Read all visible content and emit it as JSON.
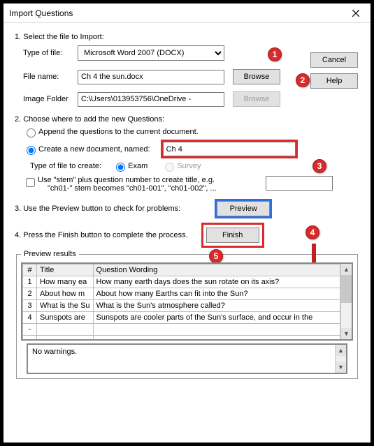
{
  "window": {
    "title": "Import Questions"
  },
  "buttons": {
    "cancel": "Cancel",
    "help": "Help",
    "browse": "Browse",
    "preview": "Preview",
    "finish": "Finish"
  },
  "section1": {
    "header": "1.  Select the file to Import:",
    "typeOfFileLabel": "Type of file:",
    "typeOfFileValue": "Microsoft Word 2007 (DOCX)",
    "fileNameLabel": "File name:",
    "fileNameValue": "Ch 4 the sun.docx",
    "imageFolderLabel": "Image Folder",
    "imageFolderValue": "C:\\Users\\013953756\\OneDrive -"
  },
  "section2": {
    "header": "2.  Choose where to add the new Questions:",
    "appendLabel": "Append the questions to the current document.",
    "createLabel": "Create a new document, named:",
    "createValue": "Ch 4",
    "typeToCreateLabel": "Type of file to create:",
    "examLabel": "Exam",
    "surveyLabel": "Survey",
    "stemLabel1": "Use \"stem\" plus question number to create title,  e.g.",
    "stemLabel2": "\"ch01-\" stem becomes \"ch01-001\", \"ch01-002\", ..."
  },
  "section3": {
    "header": "3.  Use the Preview button to check for problems:"
  },
  "section4": {
    "header": "4.  Press the Finish button to complete the process."
  },
  "preview": {
    "legend": "Preview results",
    "colNum": "#",
    "colTitle": "Title",
    "colWording": "Question Wording",
    "rows": [
      {
        "n": "1",
        "title": "How many ea",
        "wording": "How many earth days does the sun rotate on its axis?"
      },
      {
        "n": "2",
        "title": "About how m",
        "wording": "About how many Earths can fit into the Sun?"
      },
      {
        "n": "3",
        "title": "What is the Su",
        "wording": "What is the Sun's atmosphere called?"
      },
      {
        "n": "4",
        "title": "Sunspots are",
        "wording": "Sunspots are cooler parts of the Sun's surface, and occur in the"
      },
      {
        "n": "-",
        "title": "",
        "wording": ""
      },
      {
        "n": "-",
        "title": "",
        "wording": ""
      }
    ]
  },
  "warnings": {
    "text": "No warnings."
  },
  "callouts": {
    "c1": "1",
    "c2": "2",
    "c3": "3",
    "c4": "4",
    "c5": "5"
  }
}
